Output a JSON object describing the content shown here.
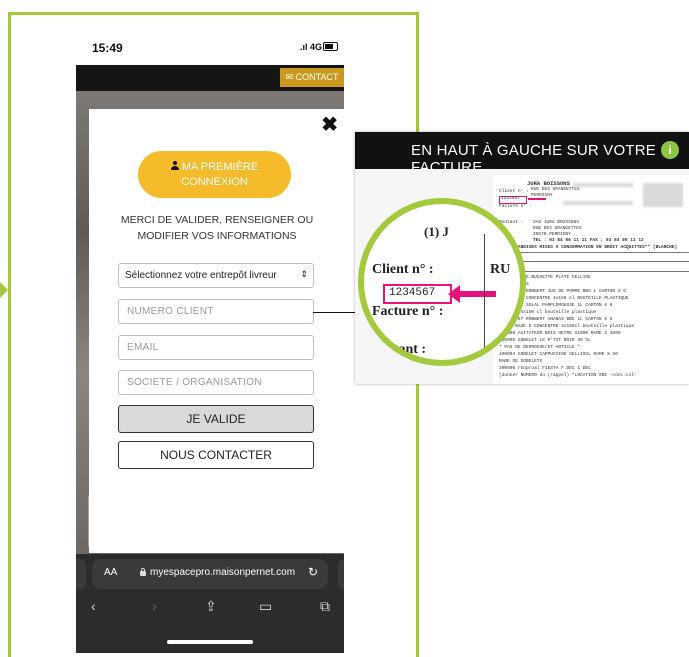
{
  "phone": {
    "time": "15:49",
    "network": "4G",
    "contact_label": "CONTACT"
  },
  "modal": {
    "close": "✖",
    "first_button": "MA PREMIÈRE CONNEXION",
    "message": "MERCI DE VALIDER, RENSEIGNER OU MODIFIER VOS INFORMATIONS",
    "select_value": "Sélectionnez votre entrepôt livreur",
    "placeholders": {
      "client": "NUMERO CLIENT",
      "email": "EMAIL",
      "societe": "SOCIETE / ORGANISATION"
    },
    "valide_label": "JE VALIDE",
    "contact_label": "NOUS CONTACTER"
  },
  "browser": {
    "aa": "AA",
    "url": "myespacepro.maisonpernet.com"
  },
  "info": {
    "title": "EN HAUT À GAUCHE SUR VOTRE FACTURE",
    "icon": "i",
    "magnifier": {
      "client_label": "Client n° :",
      "client_number": "1234567",
      "facture_label": "Facture n° :",
      "montant_label": "ntant :",
      "ru": "RU",
      "one_j": "(1) J"
    },
    "doc": {
      "company": "JURA BOISSONS",
      "street": "RUE DES GRANGETTES",
      "city": "PERRIGNY",
      "client_row": "Client n° :",
      "client_no": "1234567",
      "facture_row": "Facture n° :",
      "montant": "Montant :",
      "sas": "SAS   JURA BOISSONS",
      "rue": "RUE DES GRANGETTES",
      "perrigny": "39570  PERRIGNY",
      "tel": "TEL : 03 84 86 11 11      FAX : 03 84 86 11 12",
      "merch": "**MARCHANDISES MISES A CONSOMMATION EN DROIT ACQUITTES**       (BLANCHE)",
      "items": [
        "00030  SUCRE BUCHETTE PLATE CELLISE",
        "       5 SO R10003",
        "33057  PET ROBBERT JUS DE POMME BBC L   CARTON X 6",
        "       A BASE DE CONCENTRE 4x150 cl     BOUTEILLE PLASTIQUE",
        "33056  PET SOLAL PAMPLEMOUSSE 1L        CARTON X 6",
        "       PUR JUS 4x150 cl                 bouteille plastique",
        "33055  PET ROBBERT ANANAS  BBC 1L       CARTON X 6",
        "       JUS A BASE D CONCENTRE 4x150cl   bouteille plastique",
        "500000 AGITATEUR BOIS HETRE X1000      RAME X 1000",
        "400000 GOBELET LE P'TIT NOIR 30 CL",
        "       * PAS DE REPROCHE/ET ARTICLE *",
        "400004 GOBELET CAPPUCCINO CELLISCL     RAME X 50",
        "       RAME DE GOBELETS",
        "300000 rGoproal FIESTA F.DEC 1 DEC",
        "       (donner NUMERO du (rappel)       *LOCATION SDE -conc.col-"
      ]
    }
  }
}
